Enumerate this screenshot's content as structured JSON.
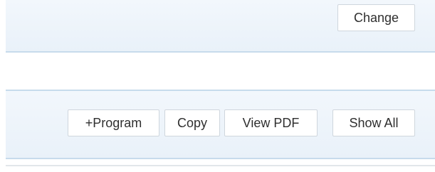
{
  "header_band": {
    "change_label": "Change"
  },
  "toolbar": {
    "program_label": "+Program",
    "copy_label": "Copy",
    "view_pdf_label": "View PDF",
    "show_all_label": "Show All"
  }
}
